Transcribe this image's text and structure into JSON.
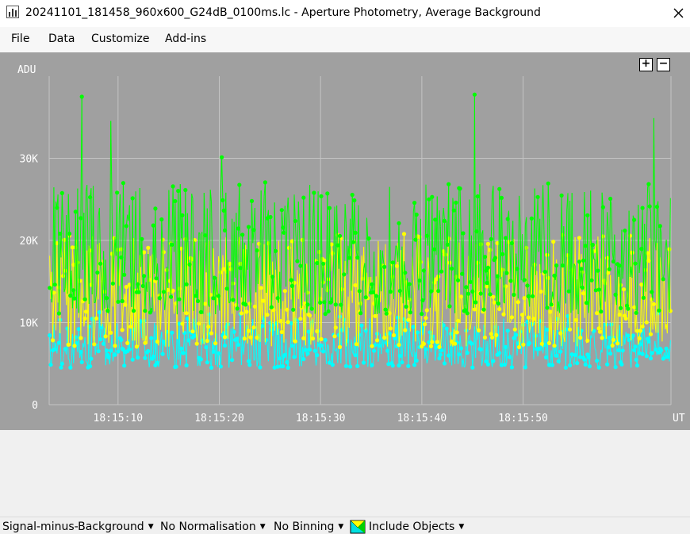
{
  "window": {
    "title": "20241101_181458_960x600_G24dB_0100ms.lc - Aperture Photometry, Average Background"
  },
  "menu": {
    "items": [
      "File",
      "Data",
      "Customize",
      "Add-ins"
    ]
  },
  "zoom": {
    "plus": "+",
    "minus": "−"
  },
  "statusbar": {
    "mode": "Signal-minus-Background",
    "normalisation": "No Normalisation",
    "binning": "No Binning",
    "include_objects": "Include Objects"
  },
  "icons": {
    "app": "lightcurve-app-icon",
    "close": "close-icon",
    "include_objects": "checkbox-objects-icon",
    "dropdown": "chevron-down-icon"
  },
  "chart_data": {
    "type": "scatter",
    "ylabel": "ADU",
    "xlabel": "UT",
    "ylim": [
      0,
      40000
    ],
    "xlim": [
      "18:15:03.2",
      "18:16:04.6"
    ],
    "yticks": [
      0,
      10000,
      20000,
      30000
    ],
    "ytick_labels": [
      "0",
      "10K",
      "20K",
      "30K"
    ],
    "xticks": [
      "18:15:10",
      "18:15:20",
      "18:15:30",
      "18:15:40",
      "18:15:50"
    ],
    "grid": true,
    "background": "#a0a0a0",
    "grid_color": "#c4c4c4",
    "point_count_per_series": 600,
    "series": [
      {
        "color": "#00ff00",
        "typical_range": [
          11000,
          27000
        ],
        "max": 39000
      },
      {
        "color": "#ffff00",
        "typical_range": [
          7000,
          20500
        ],
        "max": 20800
      },
      {
        "color": "#00ffff",
        "typical_range": [
          4500,
          10500
        ],
        "max": 11500
      }
    ]
  }
}
